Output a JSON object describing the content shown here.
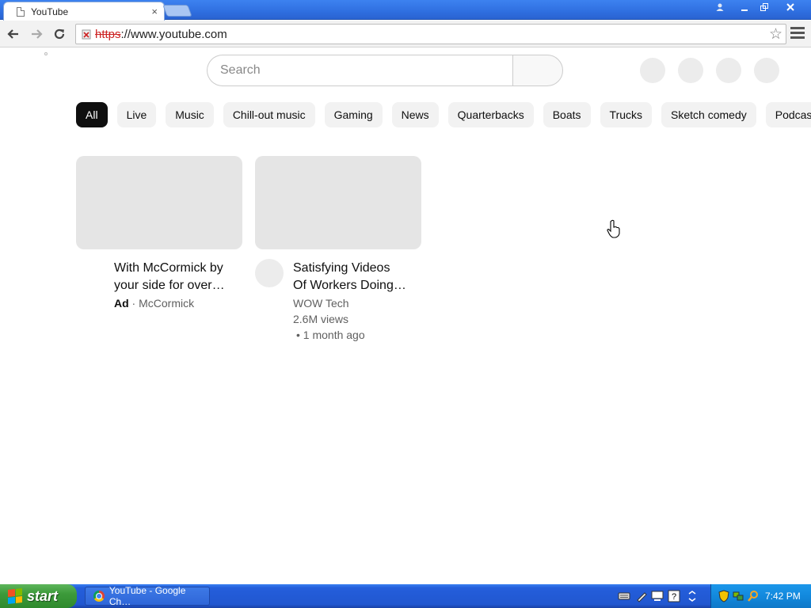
{
  "browser": {
    "tab_title": "YouTube",
    "tab_close": "×",
    "url_scheme": "https",
    "url_rest": "://www.youtube.com"
  },
  "youtube": {
    "search_placeholder": "Search",
    "chips": [
      "All",
      "Live",
      "Music",
      "Chill-out music",
      "Gaming",
      "News",
      "Quarterbacks",
      "Boats",
      "Trucks",
      "Sketch comedy",
      "Podcasts"
    ],
    "active_chip": "All",
    "videos": [
      {
        "title_line1": "With McCormick by",
        "title_line2": "your side for over…",
        "ad_label": "Ad",
        "separator": " · ",
        "channel": "McCormick"
      },
      {
        "title_line1": "Satisfying Videos",
        "title_line2": "Of Workers Doing…",
        "channel": "WOW Tech",
        "views": "2.6M views",
        "age": "• 1 month ago"
      }
    ]
  },
  "taskbar": {
    "start_label": "start",
    "task_label": "YouTube - Google Ch…",
    "clock": "7:42 PM"
  },
  "icons": {
    "back": "back-arrow-icon",
    "forward": "forward-arrow-icon",
    "reload": "reload-icon",
    "star": "bookmark-star-icon",
    "menu": "menu-icon"
  },
  "colors": {
    "chip_active_bg": "#0f0f0f",
    "chip_bg": "#f2f2f2",
    "insecure_red": "#cc2222",
    "xp_blue": "#245edb",
    "xp_green": "#3c9a3a"
  }
}
